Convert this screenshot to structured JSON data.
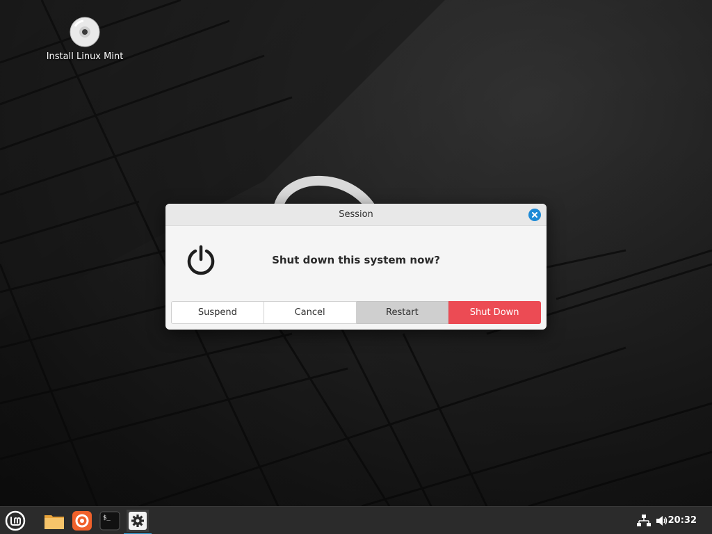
{
  "desktop": {
    "icons": [
      {
        "label": "Install Linux Mint",
        "icon": "disc-icon"
      }
    ]
  },
  "dialog": {
    "title": "Session",
    "message": "Shut down this system now?",
    "icon": "power-icon",
    "buttons": {
      "suspend": "Suspend",
      "cancel": "Cancel",
      "restart": "Restart",
      "shutdown": "Shut Down"
    },
    "colors": {
      "shutdown": "#ec4b54",
      "restart": "#cfcfcf",
      "close": "#1e8ad6"
    }
  },
  "panel": {
    "launchers": [
      {
        "name": "menu",
        "icon": "mint-menu-icon"
      },
      {
        "name": "files",
        "icon": "folder-icon"
      },
      {
        "name": "firefox",
        "icon": "firefox-icon"
      },
      {
        "name": "terminal",
        "icon": "terminal-icon"
      },
      {
        "name": "settings",
        "icon": "gear-icon",
        "active": true
      }
    ],
    "tray": {
      "network_icon": "network-icon",
      "volume_icon": "volume-icon",
      "clock": "20:32"
    },
    "accent": "#35a3dc"
  }
}
